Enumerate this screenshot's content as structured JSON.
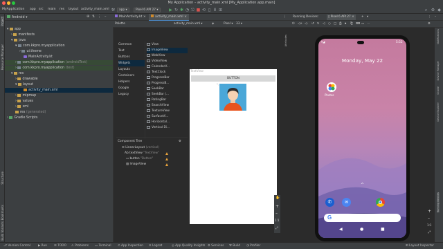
{
  "window": {
    "title": "My Application – activity_main.xml [My_Application.app.main]"
  },
  "nav": {
    "breadcrumbs": [
      "MyApplication",
      "app",
      "src",
      "main",
      "res",
      "layout",
      "activity_main.xml"
    ],
    "run_config": "app",
    "device": "Pixel 6 API 27"
  },
  "left_strip": [
    "Project",
    "Resource Manager",
    "Structure",
    "Bookmarks",
    "Build Variants"
  ],
  "project": {
    "view": "Android",
    "tree": [
      {
        "label": "app",
        "type": "folder"
      },
      {
        "label": "manifests",
        "type": "folder"
      },
      {
        "label": "java",
        "type": "folder"
      },
      {
        "label": "com.kkpro.myapplication",
        "type": "pkg"
      },
      {
        "label": "ui.theme",
        "type": "pkg"
      },
      {
        "label": "MainActivity.kt",
        "type": "kt"
      },
      {
        "label": "com.kkpro.myapplication",
        "note": "(androidTest)",
        "type": "pkg"
      },
      {
        "label": "com.kkpro.myapplication",
        "note": "(test)",
        "type": "pkg"
      },
      {
        "label": "res",
        "type": "folder"
      },
      {
        "label": "drawable",
        "type": "folder"
      },
      {
        "label": "layout",
        "type": "folder"
      },
      {
        "label": "activity_main.xml",
        "type": "xml"
      },
      {
        "label": "mipmap",
        "type": "folder"
      },
      {
        "label": "values",
        "type": "folder"
      },
      {
        "label": "xml",
        "type": "folder"
      },
      {
        "label": "res",
        "note": "(generated)",
        "type": "folder"
      },
      {
        "label": "Gradle Scripts",
        "type": "folder"
      }
    ]
  },
  "editor": {
    "tabs": [
      "MainActivity.kt",
      "activity_main.xml"
    ],
    "view_modes": [
      "Code",
      "Split",
      "Design"
    ],
    "file_selector": "activity_main.xml",
    "device_selector": "Pixel",
    "api_selector": "33",
    "palette": {
      "title": "Palette",
      "categories": [
        "Common",
        "Text",
        "Buttons",
        "Widgets",
        "Layouts",
        "Containers",
        "Helpers",
        "Google",
        "Legacy"
      ],
      "selected_category": "Widgets",
      "widgets": [
        "View",
        "ImageView",
        "WebView",
        "VideoView",
        "CalendarV...",
        "TextClock",
        "ProgressBar",
        "ProgressB...",
        "SeekBar",
        "SeekBar (...",
        "RatingBar",
        "SearchView",
        "TextureView",
        "SurfaceVi...",
        "Horizontal...",
        "Vertical Di..."
      ]
    },
    "component_tree": {
      "title": "Component Tree",
      "items": [
        {
          "label": "LinearLayout",
          "note": "(vertical)"
        },
        {
          "label": "textView",
          "note": "\"TextView\"",
          "prefix": "Ab"
        },
        {
          "label": "button",
          "note": "\"Button\""
        },
        {
          "label": "ImageView",
          "note": ""
        }
      ]
    },
    "preview": {
      "textview": "TextView",
      "button": "BUTTON"
    },
    "zoom_ratio": "1:1"
  },
  "running_devices": {
    "title": "Running Devices:",
    "device_tab": "Pixel 6 API 27",
    "phone": {
      "time": "5:52",
      "date": "Monday, May 22",
      "app_label": "Photos"
    }
  },
  "right_strip": [
    "Notifications",
    "Device Manager",
    "Gradle",
    "Device Explorer",
    "Running Devices",
    "Emulator"
  ],
  "status_bar": [
    "Version Control",
    "Run",
    "TODO",
    "Problems",
    "Terminal",
    "App Inspection",
    "Logcat",
    "App Quality Insights",
    "Services",
    "Build",
    "Profiler",
    "Layout Inspector"
  ],
  "colors": {
    "accent": "#4a88c7",
    "warning": "#e6a23c",
    "phone_wallpaper_top": "#c47a9e",
    "phone_wallpaper_bottom": "#7b77bf"
  }
}
